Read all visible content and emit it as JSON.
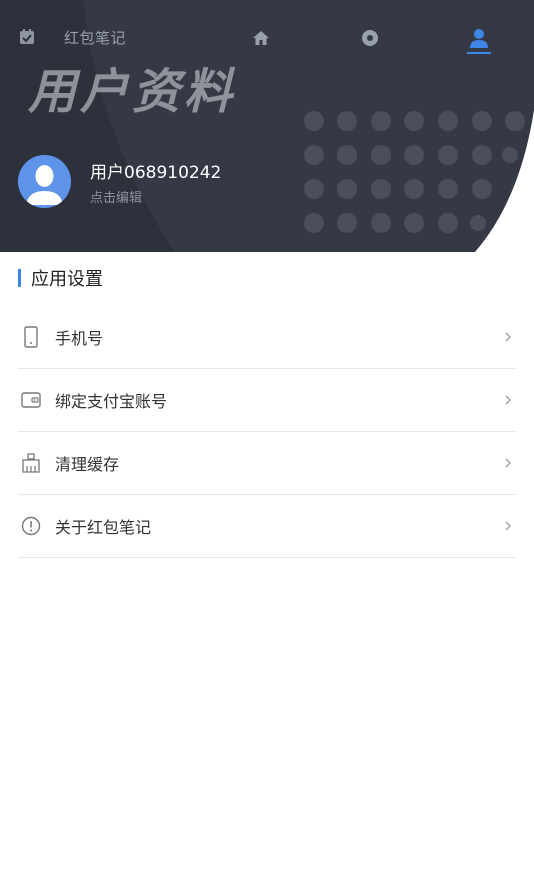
{
  "nav": {
    "title": "红包笔记",
    "icons": [
      "calendar-icon",
      "home-icon",
      "discover-icon",
      "user-icon"
    ],
    "active_tab": "user"
  },
  "header": {
    "title": "用户资料",
    "username": "用户068910242",
    "edit_hint": "点击编辑",
    "bg_color": "#2d313b",
    "accent": "#3e86e6"
  },
  "settings": {
    "section_title": "应用设置",
    "items": [
      {
        "label": "手机号",
        "icon": "phone-icon"
      },
      {
        "label": "绑定支付宝账号",
        "icon": "wallet-icon"
      },
      {
        "label": "清理缓存",
        "icon": "broom-icon"
      },
      {
        "label": "关于红包笔记",
        "icon": "info-icon"
      }
    ]
  }
}
